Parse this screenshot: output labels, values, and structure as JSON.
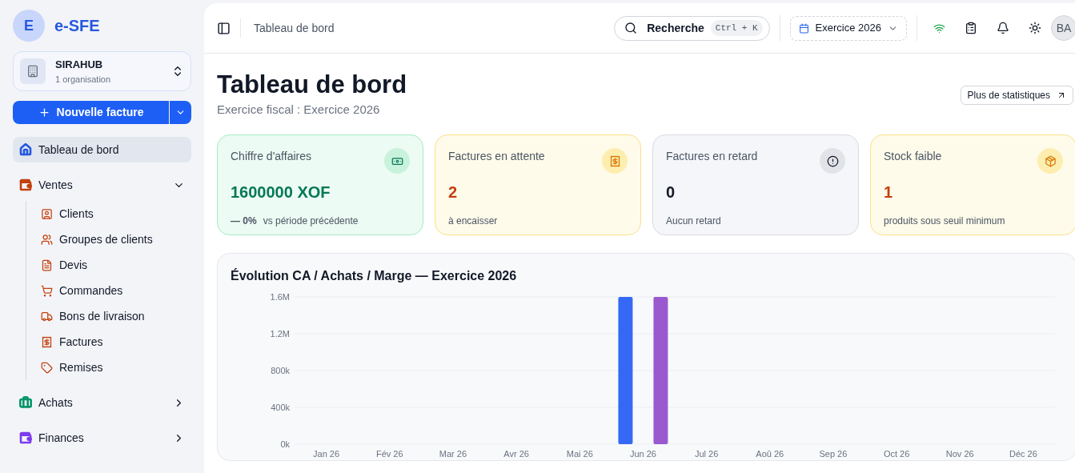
{
  "sidebar": {
    "logo": {
      "letter": "E",
      "name": "e-SFE"
    },
    "organization": {
      "name": "SIRAHUB",
      "subtitle": "1 organisation"
    },
    "new_button": {
      "label": "Nouvelle facture"
    },
    "nav": [
      {
        "label": "Tableau de bord",
        "selected": true
      },
      {
        "label": "Ventes",
        "selected": false,
        "expanded": true,
        "color": "#c2410c",
        "children": [
          {
            "label": "Clients",
            "selected": false
          },
          {
            "label": "Groupes de clients",
            "selected": false
          },
          {
            "label": "Devis",
            "selected": false
          },
          {
            "label": "Commandes",
            "selected": false
          },
          {
            "label": "Bons de livraison",
            "selected": false
          },
          {
            "label": "Factures",
            "selected": false
          },
          {
            "label": "Remises",
            "selected": false
          }
        ]
      },
      {
        "label": "Achats",
        "selected": false,
        "expanded": false,
        "color": "#059669"
      },
      {
        "label": "Finances",
        "selected": false,
        "expanded": false,
        "color": "#7c3aed"
      }
    ]
  },
  "header": {
    "breadcrumb": "Tableau de bord",
    "search": {
      "label": "Recherche",
      "shortcut": "Ctrl + K"
    },
    "fiscal_year": "Exercice 2026",
    "avatar": "BA"
  },
  "page": {
    "title": "Tableau de bord",
    "subtitle": "Exercice fiscal : Exercice 2026",
    "stats_button": "Plus de statistiques"
  },
  "cards": [
    {
      "kind": "success",
      "title": "Chiffre d'affaires",
      "value": "1600000 XOF",
      "trend": "— 0%",
      "note": "vs période précédente"
    },
    {
      "kind": "warning",
      "title": "Factures en attente",
      "value": "2",
      "note": "à encaisser"
    },
    {
      "kind": "neutral",
      "title": "Factures en retard",
      "value": "0",
      "note": "Aucun retard"
    },
    {
      "kind": "warning",
      "title": "Stock faible",
      "value": "1",
      "note": "produits sous seuil minimum"
    }
  ],
  "chart": {
    "chart_data": {
      "type": "bar",
      "title": "Évolution CA / Achats / Marge — Exercice 2026",
      "categories": [
        "Jan 26",
        "Fév 26",
        "Mar 26",
        "Avr 26",
        "Mai 26",
        "Jun 26",
        "Jul 26",
        "Aoû 26",
        "Sep 26",
        "Oct 26",
        "Nov 26",
        "Déc 26"
      ],
      "series": [
        {
          "color": "#3569f5",
          "values": [
            0,
            0,
            0,
            0,
            0,
            1600000,
            0,
            0,
            0,
            0,
            0,
            0
          ]
        },
        {
          "color": "#9b59d0",
          "values": [
            0,
            0,
            0,
            0,
            0,
            1600000,
            0,
            0,
            0,
            0,
            0,
            0
          ]
        }
      ],
      "ylim": [
        0,
        1600000
      ],
      "grid": true,
      "yticks": [
        {
          "value": 0,
          "label": "0k"
        },
        {
          "value": 400000,
          "label": "400k"
        },
        {
          "value": 800000,
          "label": "800k"
        },
        {
          "value": 1200000,
          "label": "1.2M"
        },
        {
          "value": 1600000,
          "label": "1.6M"
        }
      ]
    }
  }
}
